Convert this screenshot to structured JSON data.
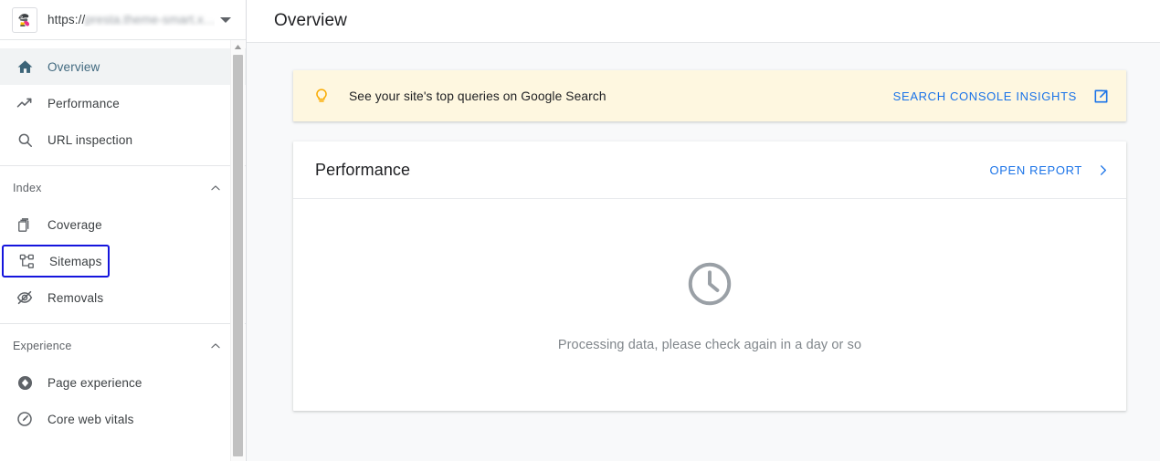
{
  "sidebar": {
    "property": {
      "favicon_name": "site-favicon",
      "url_scheme": "https://",
      "url_host": "presta.theme-smart.x…",
      "dropdown_icon": "chevron-down-icon"
    },
    "primary_items": [
      {
        "label": "Overview",
        "icon": "home-icon",
        "state": "active"
      },
      {
        "label": "Performance",
        "icon": "trending-up-icon",
        "state": "default"
      },
      {
        "label": "URL inspection",
        "icon": "search-icon",
        "state": "default"
      }
    ],
    "sections": [
      {
        "title": "Index",
        "collapse_icon": "chevron-up-icon",
        "items": [
          {
            "label": "Coverage",
            "icon": "copy-pages-icon",
            "state": "default"
          },
          {
            "label": "Sitemaps",
            "icon": "sitemap-tree-icon",
            "state": "focused"
          },
          {
            "label": "Removals",
            "icon": "eye-off-icon",
            "state": "default"
          }
        ]
      },
      {
        "title": "Experience",
        "collapse_icon": "chevron-up-icon",
        "items": [
          {
            "label": "Page experience",
            "icon": "page-experience-icon",
            "state": "default"
          },
          {
            "label": "Core web vitals",
            "icon": "speedometer-icon",
            "state": "default"
          }
        ]
      }
    ],
    "scrollbar": {
      "up_arrow_icon": "scroll-up-arrow-icon"
    }
  },
  "header": {
    "title": "Overview"
  },
  "banner": {
    "icon": "lightbulb-icon",
    "message": "See your site's top queries on Google Search",
    "action_label": "SEARCH CONSOLE INSIGHTS",
    "action_icon": "open-in-new-icon",
    "background": "#fef7e0",
    "icon_color": "#f9ab00",
    "link_color": "#1a73e8"
  },
  "performance_card": {
    "title": "Performance",
    "action_label": "OPEN REPORT",
    "action_icon": "chevron-right-icon",
    "empty_state": {
      "icon": "clock-icon",
      "message": "Processing data, please check again in a day or so",
      "icon_color": "#9aa0a6",
      "text_color": "#80868b"
    }
  }
}
